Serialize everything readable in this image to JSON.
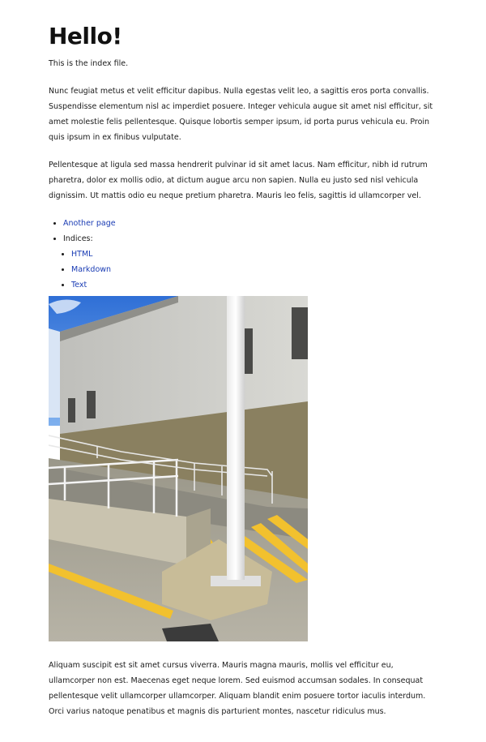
{
  "heading": "Hello!",
  "intro": "This is the index file.",
  "paragraphs": [
    "Nunc feugiat metus et velit efficitur dapibus. Nulla egestas velit leo, a sagittis eros porta convallis. Suspendisse elementum nisl ac imperdiet posuere. Integer vehicula augue sit amet nisl efficitur, sit amet molestie felis pellentesque. Quisque lobortis semper ipsum, id porta purus vehicula eu. Proin quis ipsum in ex finibus vulputate.",
    "Pellentesque at ligula sed massa hendrerit pulvinar id sit amet lacus. Nam efficitur, nibh id rutrum pharetra, dolor ex mollis odio, at dictum augue arcu non sapien. Nulla eu justo sed nisl vehicula dignissim. Ut mattis odio eu neque pretium pharetra. Mauris leo felis, sagittis id ullamcorper vel.",
    "Aliquam suscipit est sit amet cursus viverra. Mauris magna mauris, mollis vel efficitur eu, ullamcorper non est. Maecenas eget neque lorem. Sed euismod accumsan sodales. In consequat pellentesque velit ullamcorper ullamcorper. Aliquam blandit enim posuere tortor iaculis interdum. Orci varius natoque penatibus et magnis dis parturient montes, nascetur ridiculus mus."
  ],
  "links": {
    "another_page": "Another page",
    "indices_label": "Indices:",
    "indices": [
      "HTML",
      "Markdown",
      "Text"
    ]
  },
  "colors": {
    "link": "#1a3cb4",
    "text": "#1a1a1a",
    "stripe_yellow": "#f2c12e"
  }
}
